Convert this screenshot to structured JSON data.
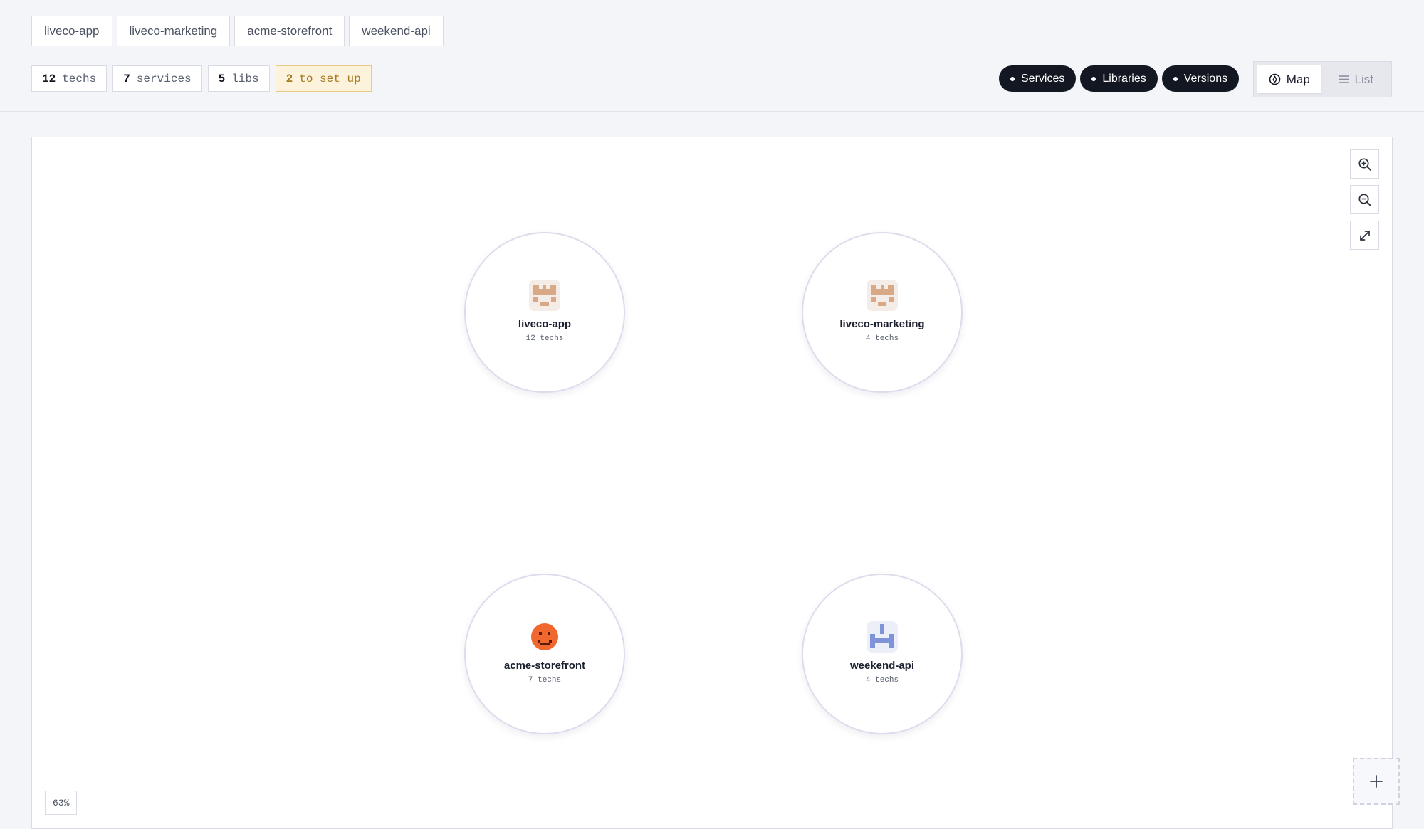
{
  "projects": [
    "liveco-app",
    "liveco-marketing",
    "acme-storefront",
    "weekend-api"
  ],
  "stats": {
    "techs": {
      "count": "12",
      "label": "techs"
    },
    "services": {
      "count": "7",
      "label": "services"
    },
    "libs": {
      "count": "5",
      "label": "libs"
    },
    "setup": {
      "count": "2",
      "label": "to set up"
    }
  },
  "filters": {
    "services": "Services",
    "libraries": "Libraries",
    "versions": "Versions"
  },
  "view_toggle": {
    "map": "Map",
    "list": "List",
    "active": "map"
  },
  "nodes": [
    {
      "name": "liveco-app",
      "count": "12 techs",
      "avatar": "pixel-box-avatar"
    },
    {
      "name": "liveco-marketing",
      "count": "4 techs",
      "avatar": "pixel-box-avatar"
    },
    {
      "name": "acme-storefront",
      "count": "7 techs",
      "avatar": "orange-face-avatar"
    },
    {
      "name": "weekend-api",
      "count": "4 techs",
      "avatar": "blue-pixel-avatar"
    }
  ],
  "zoom_level": "63%",
  "icons": {
    "zoom_in": "zoom-in-icon",
    "zoom_out": "zoom-out-icon",
    "fullscreen": "expand-icon",
    "add": "plus-icon"
  },
  "colors": {
    "dark_pill": "#131722",
    "warn_bg": "#fdf3dd",
    "warn_text": "#a5791e",
    "avatar_tan": "#d9a887",
    "avatar_orange": "#f0682e",
    "avatar_blue": "#7f94d8"
  }
}
